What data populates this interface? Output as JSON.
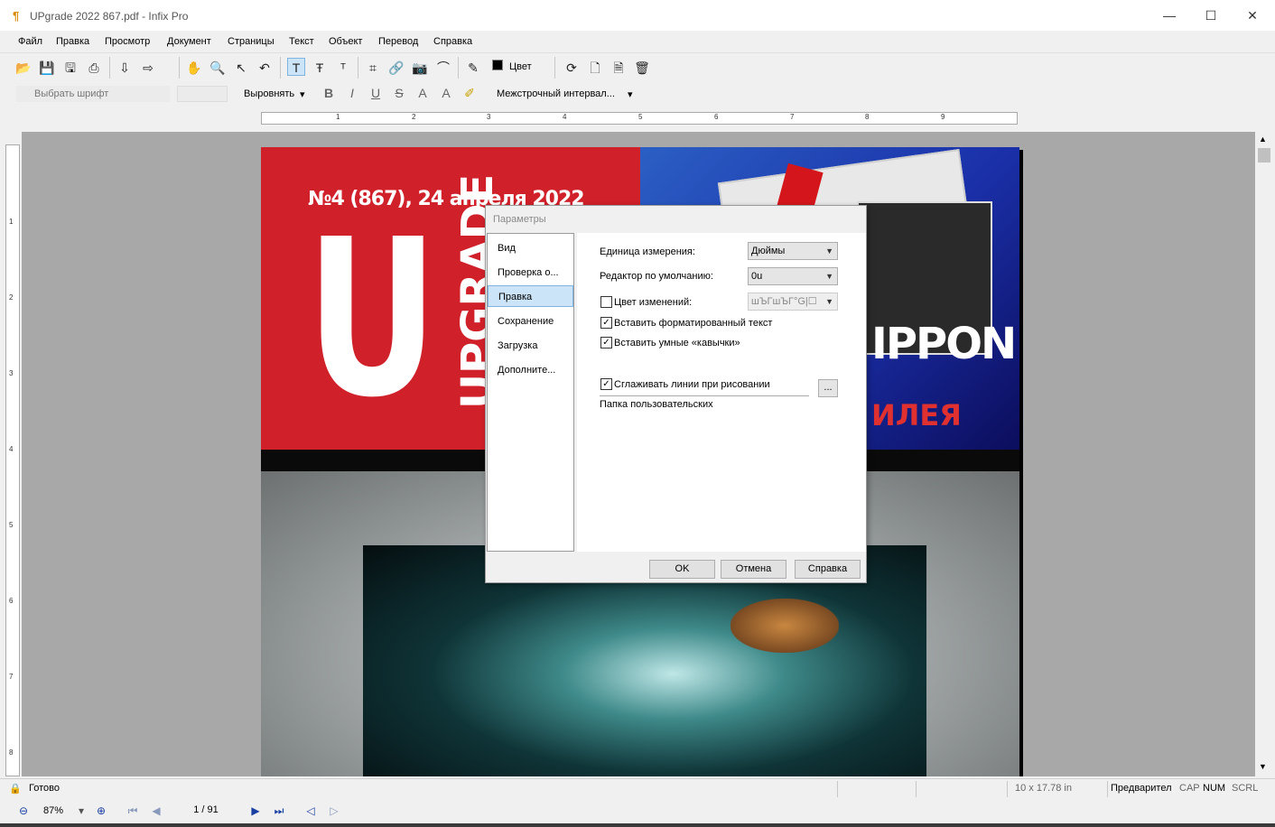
{
  "window": {
    "title": "UPgrade 2022 867.pdf - Infix Pro",
    "minimize": "—",
    "maximize": "☐",
    "close": "✕"
  },
  "menu": [
    "Файл",
    "Правка",
    "Просмотр",
    "Документ",
    "Страницы",
    "Текст",
    "Объект",
    "Перевод",
    "Справка"
  ],
  "toolbar": {
    "color_label": "Цвет",
    "font_placeholder": "Выбрать шрифт",
    "align_label": "Выровнять",
    "line_spacing_label": "Межстрочный интервал...",
    "bold": "B",
    "italic": "I",
    "underline": "U",
    "strike": "S",
    "superscript": "A",
    "subscript": "A"
  },
  "ruler": {
    "h_marks": [
      "1",
      "2",
      "3",
      "4",
      "5",
      "6",
      "7",
      "8",
      "9"
    ],
    "v_marks": [
      "1",
      "2",
      "3",
      "4",
      "5",
      "6",
      "7",
      "8"
    ]
  },
  "document": {
    "issue": "№4 (867), 24 апреля 2022",
    "big_letter": "U",
    "vertical_title": "UPGRADE",
    "headline": "IPPON",
    "subhead": "ИЛЕЯ"
  },
  "dialog": {
    "title": "Параметры",
    "categories": [
      "Вид",
      "Проверка о...",
      "Правка",
      "Сохранение",
      "Загрузка",
      "Дополните..."
    ],
    "selected_category": "Правка",
    "units_label": "Единица измерения:",
    "units_value": "Дюймы",
    "editor_label": "Редактор по умолчанию:",
    "editor_value": "0u",
    "change_color_label": "Цвет изменений:",
    "change_color_value": "шЪГшЪГ°G|☐",
    "paste_formatted_label": "Вставить форматированный текст",
    "smart_quotes_label": "Вставить умные «кавычки»",
    "smooth_lines_label": "Сглаживать линии при рисовании",
    "user_folder_label": "Папка пользовательских",
    "browse_label": "...",
    "ok": "OK",
    "cancel": "Отмена",
    "help": "Справка",
    "checks": {
      "change_color": false,
      "paste_formatted": true,
      "smart_quotes": true,
      "smooth_lines": true
    }
  },
  "status": {
    "ready": "Готово",
    "page_size": "10 x 17.78 in",
    "mode": "Предварител",
    "cap": "CAP",
    "num": "NUM",
    "scrl": "SCRL"
  },
  "navigation": {
    "zoom": "87%",
    "page": "1 / 91"
  }
}
